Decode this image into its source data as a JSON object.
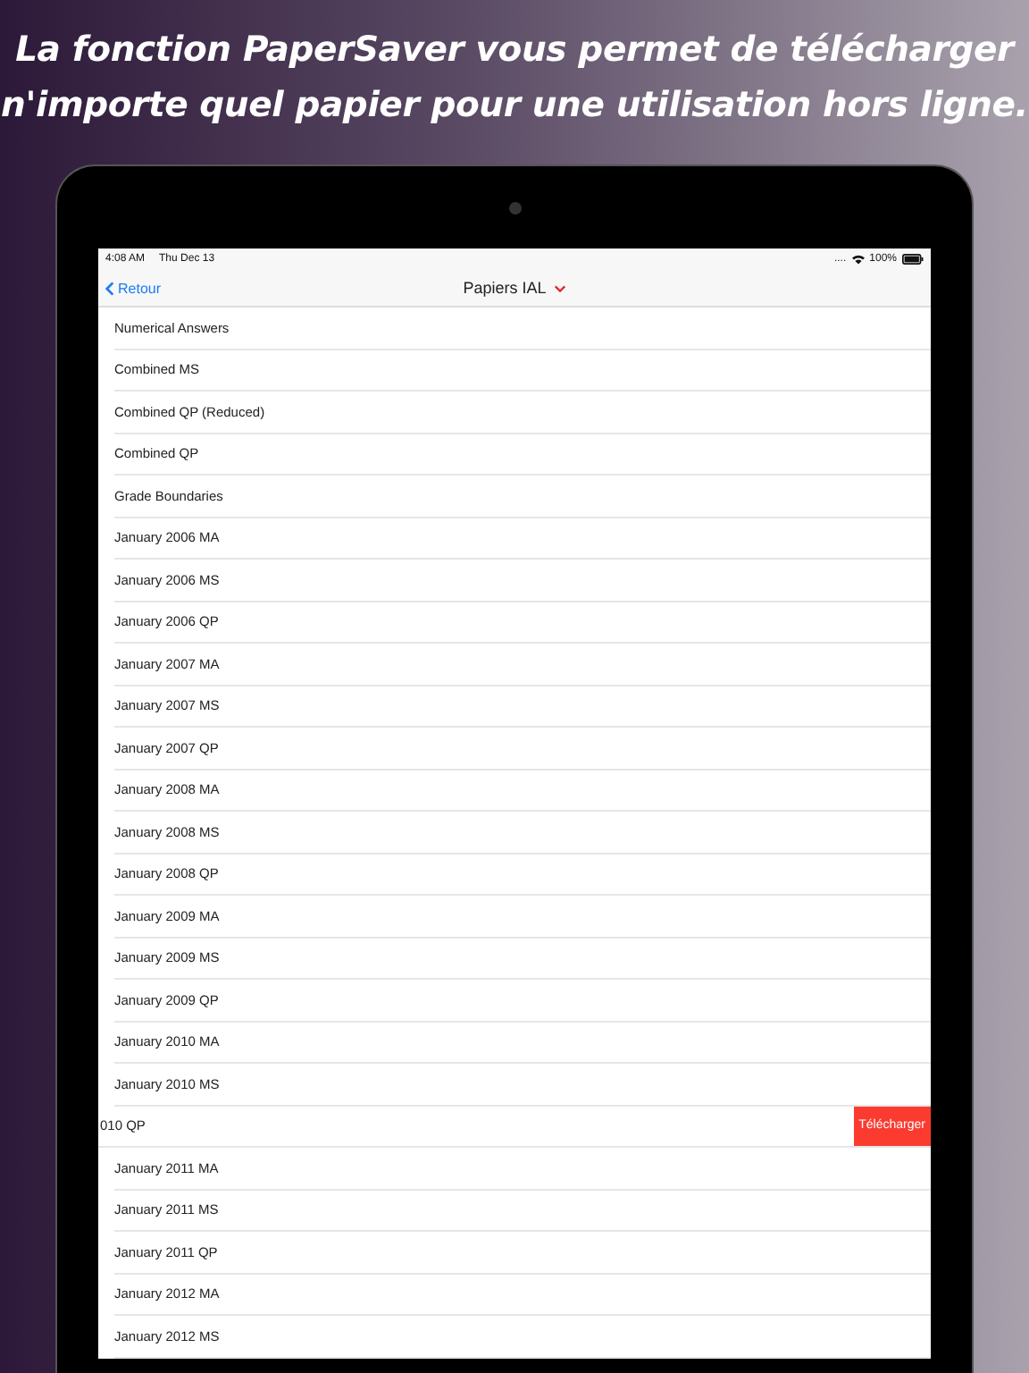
{
  "headline": [
    "La fonction PaperSaver vous permet de télécharger",
    "n'importe quel papier pour une utilisation hors ligne."
  ],
  "status_bar": {
    "time": "4:08 AM",
    "date": "Thu Dec 13",
    "signal": "....",
    "battery": "100%"
  },
  "nav": {
    "back": "Retour",
    "title": "Papiers IAL"
  },
  "rows": [
    {
      "kind": "normal",
      "label": "Numerical Answers"
    },
    {
      "kind": "normal",
      "label": "Combined MS"
    },
    {
      "kind": "normal",
      "label": "Combined QP (Reduced)"
    },
    {
      "kind": "normal",
      "label": "Combined QP"
    },
    {
      "kind": "normal",
      "label": "Grade Boundaries"
    },
    {
      "kind": "normal",
      "label": "January 2006 MA"
    },
    {
      "kind": "normal",
      "label": "January 2006 MS"
    },
    {
      "kind": "normal",
      "label": "January 2006 QP"
    },
    {
      "kind": "normal",
      "label": "January 2007 MA"
    },
    {
      "kind": "normal",
      "label": "January 2007 MS"
    },
    {
      "kind": "normal",
      "label": "January 2007 QP"
    },
    {
      "kind": "normal",
      "label": "January 2008 MA"
    },
    {
      "kind": "normal",
      "label": "January 2008 MS"
    },
    {
      "kind": "normal",
      "label": "January 2008 QP"
    },
    {
      "kind": "normal",
      "label": "January 2009 MA"
    },
    {
      "kind": "normal",
      "label": "January 2009 MS"
    },
    {
      "kind": "normal",
      "label": "January 2009 QP"
    },
    {
      "kind": "normal",
      "label": "January 2010 MA"
    },
    {
      "kind": "normal",
      "label": "January 2010 MS"
    },
    {
      "kind": "swiped",
      "label": "010 QP",
      "action": "Télécharger"
    },
    {
      "kind": "normal",
      "label": "January 2011 MA"
    },
    {
      "kind": "normal",
      "label": "January 2011 MS"
    },
    {
      "kind": "normal",
      "label": "January 2011 QP"
    },
    {
      "kind": "normal",
      "label": "January 2012 MA"
    },
    {
      "kind": "normal",
      "label": "January 2012 MS"
    }
  ]
}
